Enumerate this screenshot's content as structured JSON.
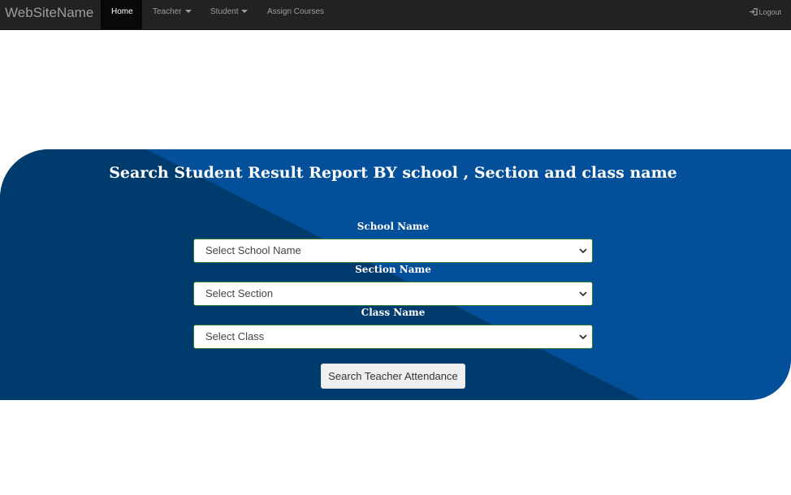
{
  "navbar": {
    "brand": "WebSiteName",
    "items": [
      {
        "label": "Home",
        "active": true
      },
      {
        "label": "Teacher",
        "dropdown": true
      },
      {
        "label": "Student",
        "dropdown": true
      },
      {
        "label": "Assign Courses"
      }
    ],
    "logout_label": "Logout"
  },
  "search": {
    "title": "Search Student Result Report BY school , Section and class name",
    "school": {
      "label": "School Name",
      "selected": "Select School Name"
    },
    "section": {
      "label": "Section Name",
      "selected": "Select Section"
    },
    "class": {
      "label": "Class Name",
      "selected": "Select Class"
    },
    "button_label": "Search Teacher Attendance"
  },
  "colors": {
    "navbar_bg": "#222222",
    "hero_primary": "#034f9a",
    "hero_shade": "#003b6e"
  },
  "icons": [
    "caret-down-icon",
    "login-icon",
    "chevron-down-icon"
  ]
}
